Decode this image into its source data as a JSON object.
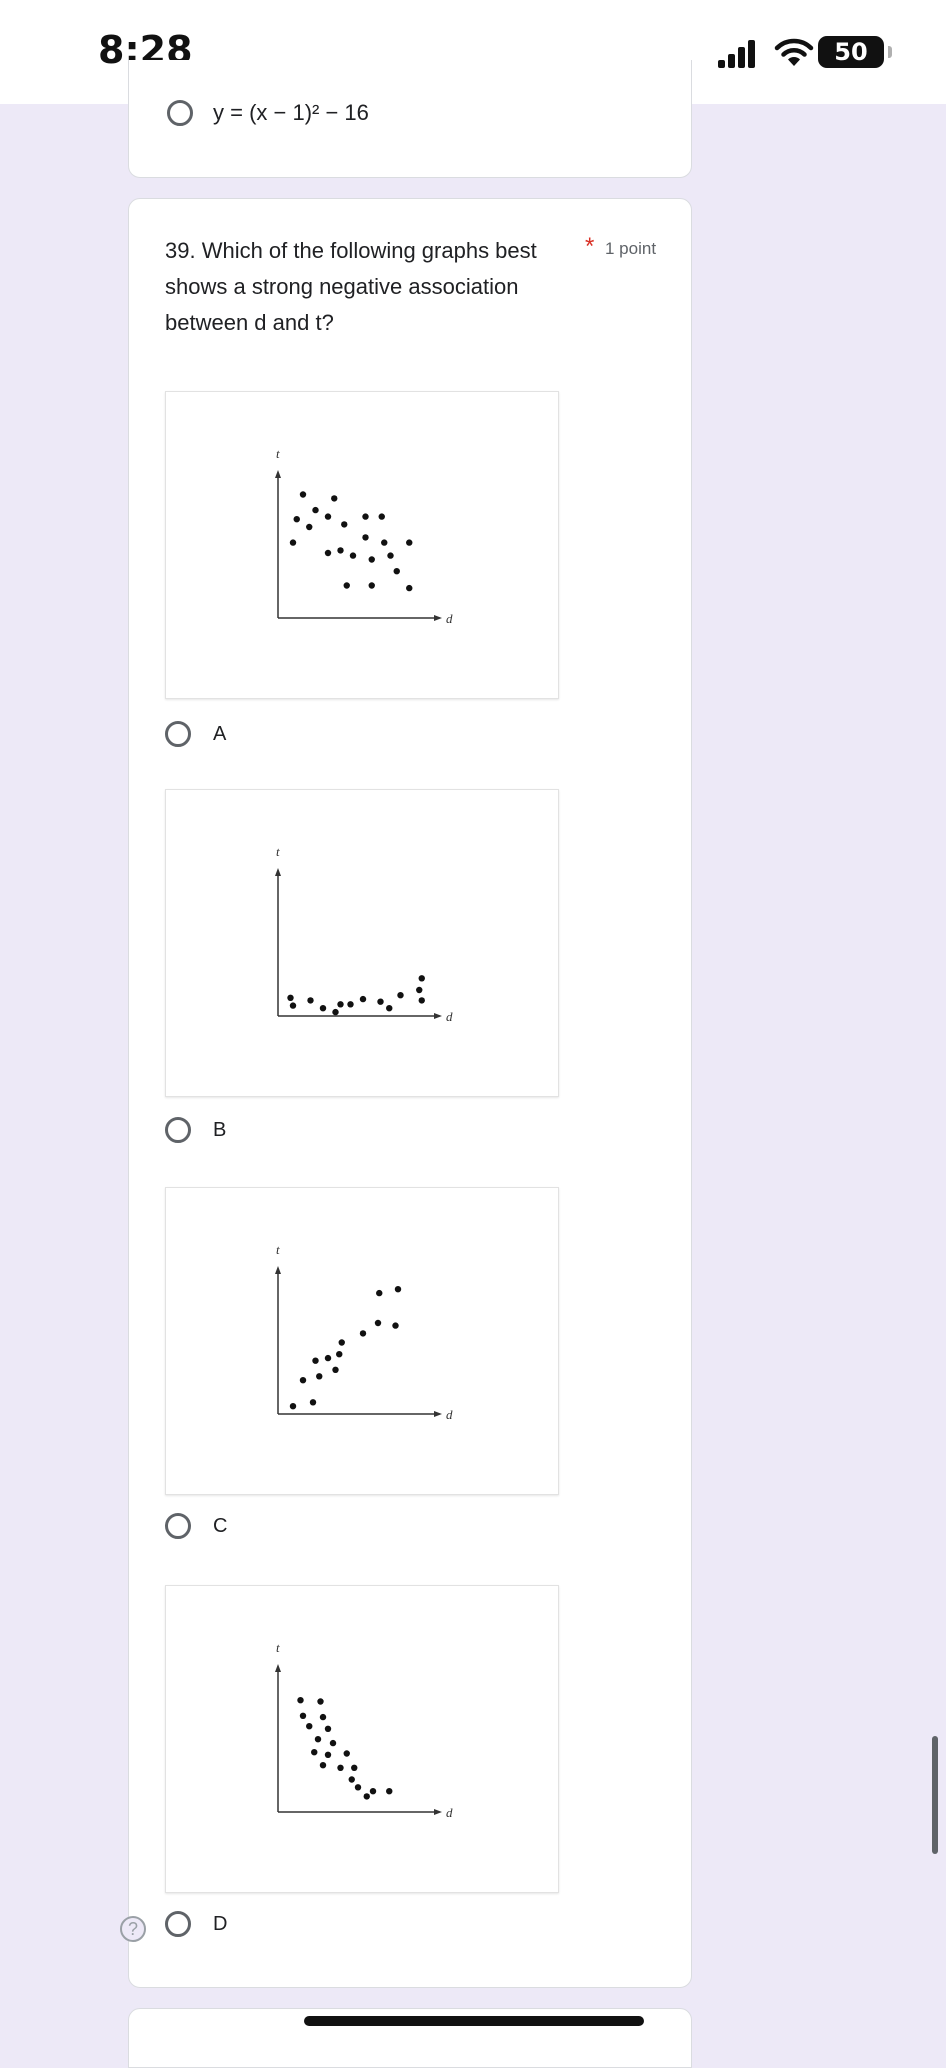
{
  "status_bar": {
    "time": "8:28",
    "battery": "50",
    "icons": [
      "signal-bars-icon",
      "wifi-icon",
      "battery-icon"
    ]
  },
  "previous_question": {
    "option_text": "y = (x − 1)² − 16"
  },
  "question": {
    "title": "39. Which of the following graphs best shows a strong negative association between d and t?",
    "required_mark": "*",
    "points": "1 point",
    "options": [
      {
        "label": "A",
        "chart_data": {
          "type": "scatter",
          "xlabel": "d",
          "ylabel": "t",
          "points": [
            [
              2,
              9.5
            ],
            [
              4.5,
              9.2
            ],
            [
              3,
              8.3
            ],
            [
              4,
              7.8
            ],
            [
              5.3,
              7.2
            ],
            [
              7,
              7.8
            ],
            [
              8.3,
              7.8
            ],
            [
              1.5,
              7.6
            ],
            [
              2.5,
              7
            ],
            [
              1.2,
              5.8
            ],
            [
              7,
              6.2
            ],
            [
              8.5,
              5.8
            ],
            [
              10.5,
              5.8
            ],
            [
              4,
              5
            ],
            [
              5,
              5.2
            ],
            [
              6,
              4.8
            ],
            [
              7.5,
              4.5
            ],
            [
              9,
              4.8
            ],
            [
              5.5,
              2.5
            ],
            [
              7.5,
              2.5
            ],
            [
              9.5,
              3.6
            ],
            [
              10.5,
              2.3
            ]
          ]
        }
      },
      {
        "label": "B",
        "chart_data": {
          "type": "scatter",
          "xlabel": "d",
          "ylabel": "t",
          "points": [
            [
              1,
              1.4
            ],
            [
              1.2,
              0.8
            ],
            [
              2.6,
              1.2
            ],
            [
              3.6,
              0.6
            ],
            [
              4.6,
              0.3
            ],
            [
              5.8,
              0.9
            ],
            [
              6.8,
              1.3
            ],
            [
              8.2,
              1.1
            ],
            [
              8.9,
              0.6
            ],
            [
              9.8,
              1.6
            ],
            [
              11.3,
              2
            ],
            [
              11.5,
              1.2
            ],
            [
              11.5,
              2.9
            ],
            [
              5,
              0.9
            ]
          ]
        }
      },
      {
        "label": "C",
        "chart_data": {
          "type": "scatter",
          "xlabel": "d",
          "ylabel": "t",
          "points": [
            [
              1.2,
              0.6
            ],
            [
              2.8,
              0.9
            ],
            [
              2,
              2.6
            ],
            [
              3.3,
              2.9
            ],
            [
              4.6,
              3.4
            ],
            [
              3,
              4.1
            ],
            [
              4,
              4.3
            ],
            [
              4.9,
              4.6
            ],
            [
              5.1,
              5.5
            ],
            [
              6.8,
              6.2
            ],
            [
              8,
              7
            ],
            [
              9.4,
              6.8
            ],
            [
              8.1,
              9.3
            ],
            [
              9.6,
              9.6
            ]
          ]
        }
      },
      {
        "label": "D",
        "chart_data": {
          "type": "scatter",
          "xlabel": "d",
          "ylabel": "t",
          "points": [
            [
              1.8,
              8.6
            ],
            [
              3.4,
              8.5
            ],
            [
              2,
              7.4
            ],
            [
              3.6,
              7.3
            ],
            [
              2.5,
              6.6
            ],
            [
              4,
              6.4
            ],
            [
              3.2,
              5.6
            ],
            [
              4.4,
              5.3
            ],
            [
              2.9,
              4.6
            ],
            [
              4,
              4.4
            ],
            [
              5.5,
              4.5
            ],
            [
              3.6,
              3.6
            ],
            [
              5,
              3.4
            ],
            [
              6.1,
              3.4
            ],
            [
              5.9,
              2.5
            ],
            [
              6.4,
              1.9
            ],
            [
              7.6,
              1.6
            ],
            [
              8.9,
              1.6
            ],
            [
              7.1,
              1.2
            ]
          ]
        }
      }
    ]
  }
}
